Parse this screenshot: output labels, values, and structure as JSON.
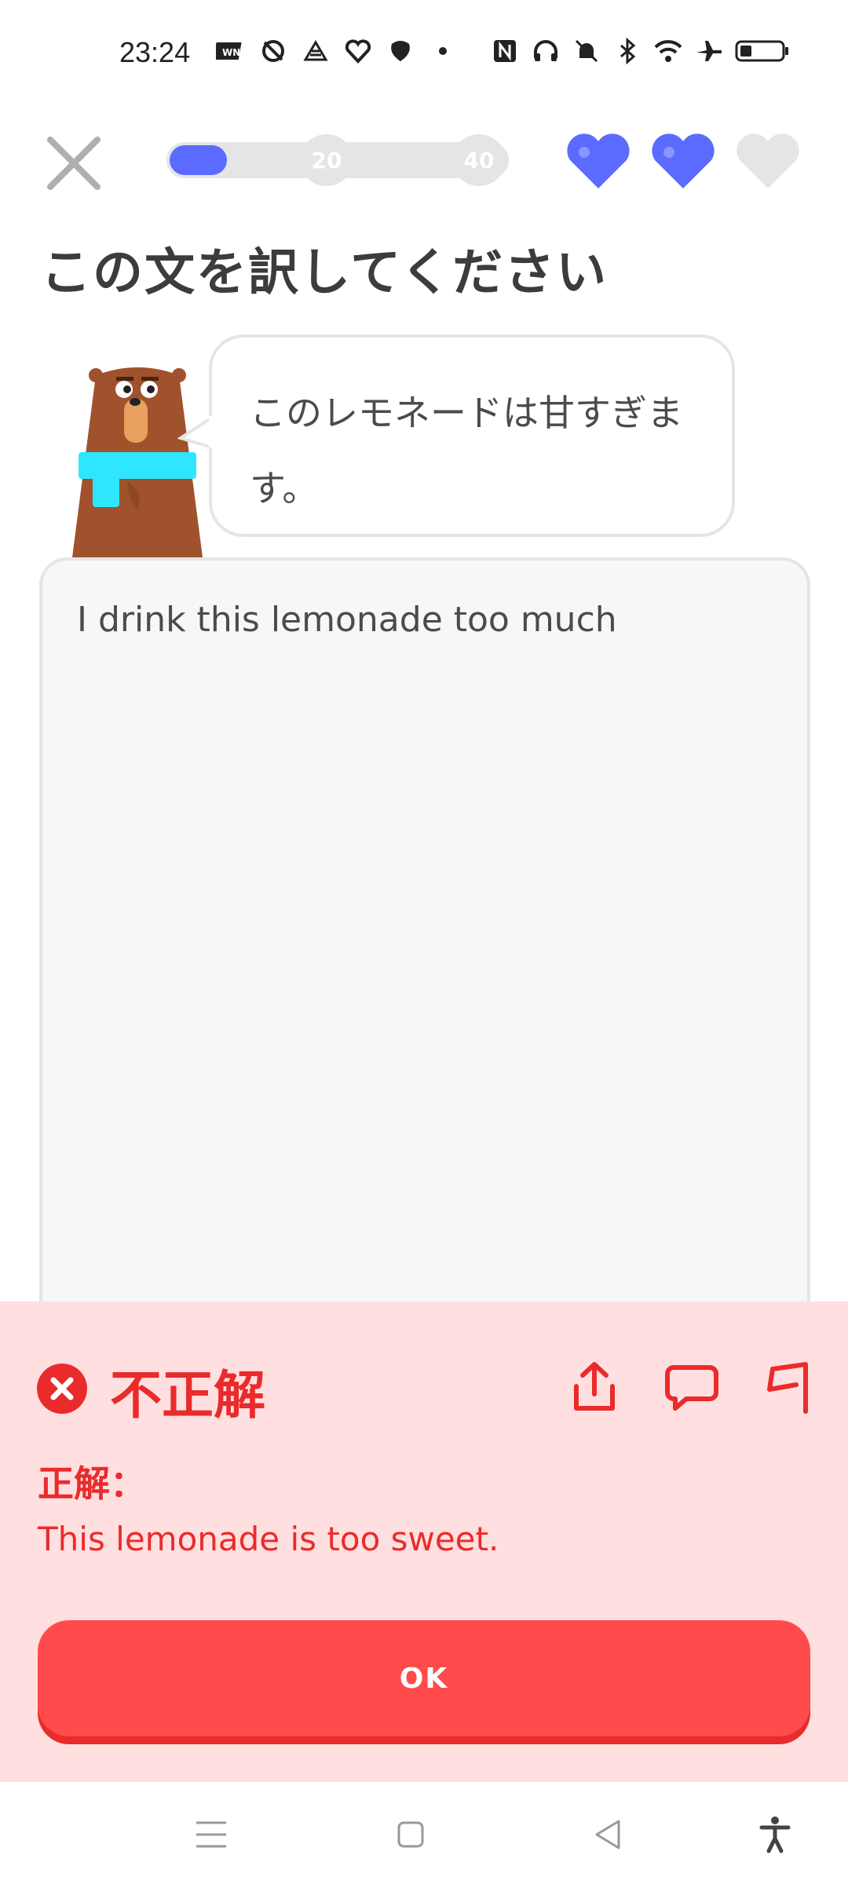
{
  "status_bar": {
    "time": "23:24",
    "left_icons": [
      "wn-app-icon",
      "sync-icon",
      "app-icon",
      "heart-app-icon",
      "leaf-app-icon",
      "dot-icon"
    ],
    "right_icons": [
      "nfc-icon",
      "headphones-icon",
      "bell-off-icon",
      "bluetooth-icon",
      "wifi-icon",
      "airplane-icon",
      "battery-icon"
    ]
  },
  "header": {
    "progress_fraction": 0.17,
    "milestones": [
      "20",
      "40"
    ],
    "hearts": [
      {
        "icon": "heart-icon",
        "filled": true
      },
      {
        "icon": "heart-icon",
        "filled": true
      },
      {
        "icon": "heart-icon",
        "filled": false
      }
    ]
  },
  "exercise": {
    "prompt": "この文を訳してください",
    "sentence": "このレモネードは甘すぎます。",
    "user_answer": "I drink this lemonade too much"
  },
  "feedback": {
    "title": "不正解",
    "correct_label": "正解：",
    "correct_answer": "This lemonade is too sweet.",
    "ok_label": "OK",
    "action_icons": [
      "share-icon",
      "comment-icon",
      "flag-icon"
    ]
  },
  "colors": {
    "accent": "#5b6bff",
    "error": "#ea2b2b",
    "error_bg": "#ffdfe0",
    "button": "#ff4b4b"
  }
}
